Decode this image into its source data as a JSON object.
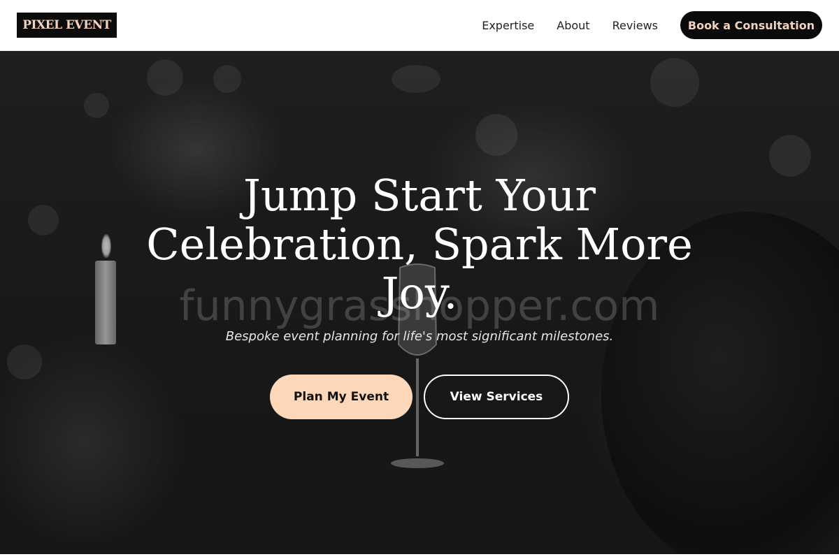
{
  "brand": {
    "name": "PIXEL EVENT"
  },
  "nav": {
    "links": [
      "Expertise",
      "About",
      "Reviews"
    ],
    "cta_label": "Book a Consultation"
  },
  "hero": {
    "title": "Jump Start Your Celebration, Spark More Joy.",
    "subtitle": "Bespoke event planning for life's most significant milestones.",
    "primary_label": "Plan My Event",
    "secondary_label": "View Services",
    "watermark": "funnygrasshopper.com"
  },
  "colors": {
    "accent": "#fdd7b9",
    "logo_text": "#f3d2bd",
    "dark": "#0a0a0a"
  }
}
